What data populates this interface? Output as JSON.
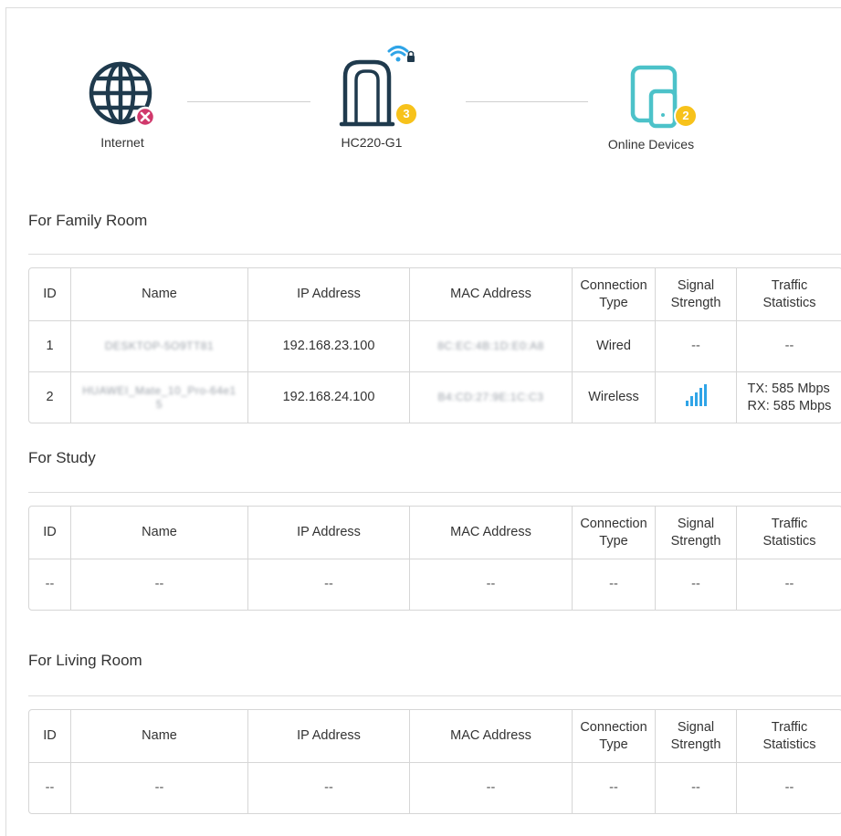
{
  "topology": {
    "internet": {
      "label": "Internet",
      "icon": "globe-icon",
      "status_icon": "disconnected-x-icon",
      "status_color": "#d0386b"
    },
    "device": {
      "label": "HC220-G1",
      "icon": "router-icon",
      "wifi_icon": "wifi-lock-icon",
      "badge": "3"
    },
    "clients": {
      "label": "Online Devices",
      "icon": "devices-icon",
      "badge": "2"
    },
    "colors": {
      "icon_dark": "#1f3a4d",
      "icon_teal": "#4cc2c9",
      "badge": "#f7c21b",
      "wifi": "#2fa4e7"
    }
  },
  "columns": [
    "ID",
    "Name",
    "IP Address",
    "MAC Address",
    "Connection\nType",
    "Signal\nStrength",
    "Traffic\nStatistics"
  ],
  "sections": [
    {
      "title": "For Family Room",
      "rows": [
        {
          "id": "1",
          "name": "DESKTOP-5O9TT81",
          "ip": "192.168.23.100",
          "mac": "8C:EC:4B:1D:E0:A8",
          "type": "Wired",
          "signal": "--",
          "traffic": "--"
        },
        {
          "id": "2",
          "name": "HUAWEI_Mate_10_Pro-64e15",
          "ip": "192.168.24.100",
          "mac": "B4:CD:27:9E:1C:C3",
          "type": "Wireless",
          "signal_level": 5,
          "tx": "TX: 585 Mbps",
          "rx": "RX: 585 Mbps"
        }
      ]
    },
    {
      "title": "For Study",
      "rows": [
        {
          "id": "--",
          "name": "--",
          "ip": "--",
          "mac": "--",
          "type": "--",
          "signal": "--",
          "traffic": "--"
        }
      ]
    },
    {
      "title": "For Living Room",
      "rows": [
        {
          "id": "--",
          "name": "--",
          "ip": "--",
          "mac": "--",
          "type": "--",
          "signal": "--",
          "traffic": "--"
        }
      ]
    }
  ]
}
